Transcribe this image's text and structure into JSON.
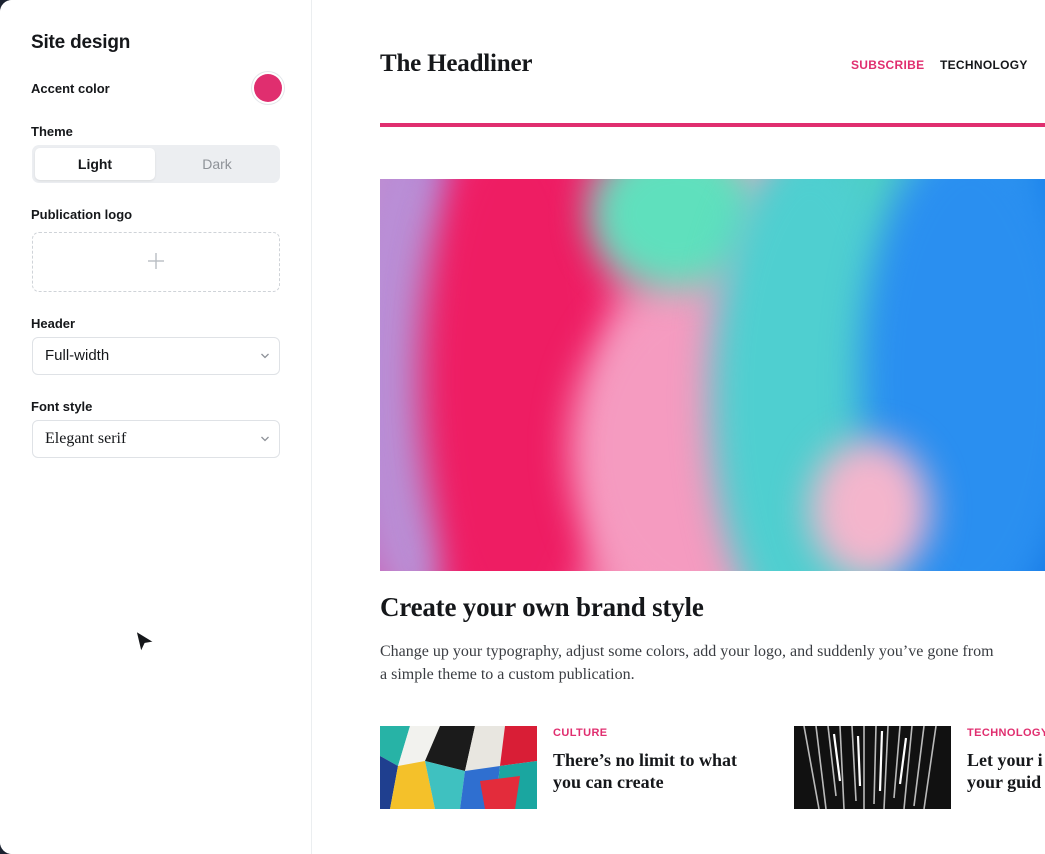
{
  "colors": {
    "accent": "#e02e6f",
    "text": "#15171a",
    "muted": "#8e9298"
  },
  "sidebar": {
    "title": "Site design",
    "accent_color": {
      "label": "Accent color",
      "value": "#e02e6f"
    },
    "theme": {
      "label": "Theme",
      "options": [
        "Light",
        "Dark"
      ],
      "selected": "Light"
    },
    "publication_logo": {
      "label": "Publication logo",
      "icon": "plus-icon"
    },
    "header": {
      "label": "Header",
      "value": "Full-width",
      "icon": "chevron-down-icon"
    },
    "font_style": {
      "label": "Font style",
      "value": "Elegant serif",
      "icon": "chevron-down-icon"
    }
  },
  "preview": {
    "site_name": "The Headliner",
    "nav": {
      "subscribe": "SUBSCRIBE",
      "technology": "TECHNOLOGY"
    },
    "featured": {
      "title": "Create your own brand style",
      "excerpt": "Change up your typography, adjust some colors, add your logo, and suddenly you’ve gone from a simple theme to a custom publication."
    },
    "cards": [
      {
        "tag": "CULTURE",
        "title": "There’s no limit to what\nyou can create"
      },
      {
        "tag": "TECHNOLOGY",
        "title": "Let your i\nyour guid"
      }
    ]
  }
}
